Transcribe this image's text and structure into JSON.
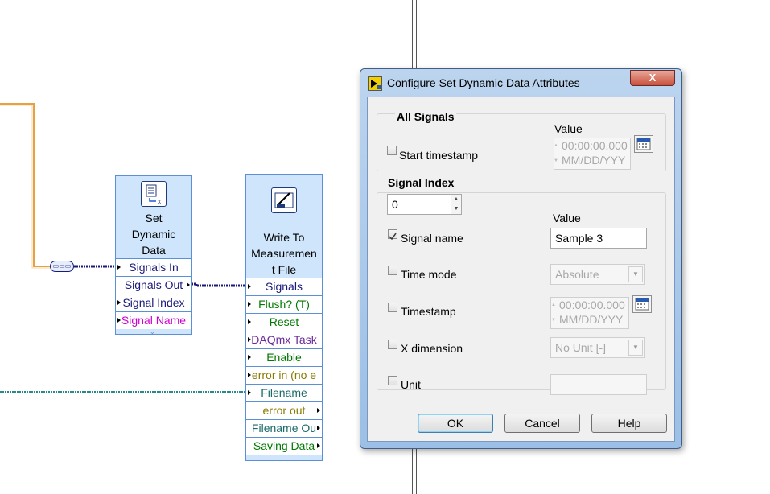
{
  "nodes": {
    "set_dynamic": {
      "title_lines": [
        "Set",
        "Dynamic",
        "Data"
      ],
      "terminals": [
        "Signals In",
        "Signals Out",
        "Signal Index",
        "Signal Name"
      ]
    },
    "write_file": {
      "title_lines": [
        "Write To",
        "Measuremen",
        "t File"
      ],
      "terminals": [
        "Signals",
        "Flush? (T)",
        "Reset",
        "DAQmx Task",
        "Enable",
        "error in (no e",
        "Filename",
        "error out",
        "Filename Ou",
        "Saving Data"
      ]
    }
  },
  "dialog": {
    "title": "Configure Set Dynamic Data Attributes",
    "close_glyph": "X",
    "all_signals": {
      "heading": "All Signals",
      "value_header": "Value",
      "start_timestamp_label": "Start timestamp",
      "time_value": "00:00:00.000",
      "date_value": "MM/DD/YYY"
    },
    "signal_index": {
      "heading": "Signal Index",
      "value": "0",
      "value_header": "Value",
      "signal_name_label": "Signal name",
      "signal_name_value": "Sample 3",
      "time_mode_label": "Time mode",
      "time_mode_value": "Absolute",
      "timestamp_label": "Timestamp",
      "time_value": "00:00:00.000",
      "date_value": "MM/DD/YYY",
      "x_dimension_label": "X dimension",
      "x_dimension_value": "No Unit [-]",
      "unit_label": "Unit",
      "unit_value": ""
    },
    "buttons": {
      "ok": "OK",
      "cancel": "Cancel",
      "help": "Help"
    }
  },
  "colors": {
    "orange_wire": "#e8a040",
    "dynamic_wire": "#1a1a7a",
    "teal_wire": "#2a8a8a",
    "node_fill": "#cfe5fb",
    "node_border": "#5b8fd6"
  }
}
